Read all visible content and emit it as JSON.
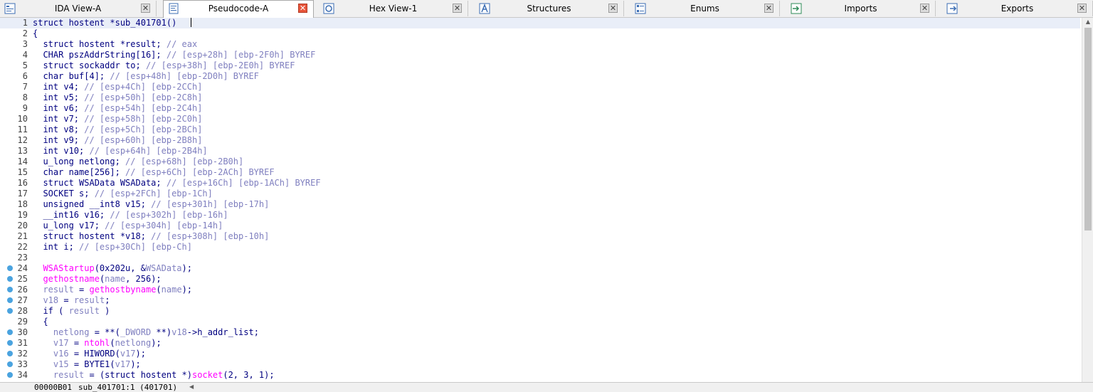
{
  "tabs": [
    {
      "label": "IDA View-A",
      "icon": "ida-view-icon",
      "active": false
    },
    {
      "label": "Pseudocode-A",
      "icon": "pseudocode-icon",
      "active": true
    },
    {
      "label": "Hex View-1",
      "icon": "hex-view-icon",
      "active": false
    },
    {
      "label": "Structures",
      "icon": "structures-icon",
      "active": false
    },
    {
      "label": "Enums",
      "icon": "enums-icon",
      "active": false
    },
    {
      "label": "Imports",
      "icon": "imports-icon",
      "active": false
    },
    {
      "label": "Exports",
      "icon": "exports-icon",
      "active": false
    }
  ],
  "close_glyph": "✕",
  "colors": {
    "keyword": "#000080",
    "comment": "#7f7fbf",
    "function": "#ff00ff",
    "variable": "#8080c0",
    "breakpoint": "#4aa3df",
    "close_active": "#e8553b"
  },
  "code_lines": [
    {
      "n": "1",
      "bp": false,
      "parts": [
        [
          "t",
          "struct hostent *sub_401701()"
        ]
      ]
    },
    {
      "n": "2",
      "bp": false,
      "parts": [
        [
          "t",
          "{"
        ]
      ]
    },
    {
      "n": "3",
      "bp": false,
      "parts": [
        [
          "t",
          "  struct hostent *result; "
        ],
        [
          "c",
          "// eax"
        ]
      ]
    },
    {
      "n": "4",
      "bp": false,
      "parts": [
        [
          "t",
          "  CHAR pszAddrString[16]; "
        ],
        [
          "c",
          "// [esp+28h] [ebp-2F0h] BYREF"
        ]
      ]
    },
    {
      "n": "5",
      "bp": false,
      "parts": [
        [
          "t",
          "  struct sockaddr to; "
        ],
        [
          "c",
          "// [esp+38h] [ebp-2E0h] BYREF"
        ]
      ]
    },
    {
      "n": "6",
      "bp": false,
      "parts": [
        [
          "t",
          "  char buf[4]; "
        ],
        [
          "c",
          "// [esp+48h] [ebp-2D0h] BYREF"
        ]
      ]
    },
    {
      "n": "7",
      "bp": false,
      "parts": [
        [
          "t",
          "  int v4; "
        ],
        [
          "c",
          "// [esp+4Ch] [ebp-2CCh]"
        ]
      ]
    },
    {
      "n": "8",
      "bp": false,
      "parts": [
        [
          "t",
          "  int v5; "
        ],
        [
          "c",
          "// [esp+50h] [ebp-2C8h]"
        ]
      ]
    },
    {
      "n": "9",
      "bp": false,
      "parts": [
        [
          "t",
          "  int v6; "
        ],
        [
          "c",
          "// [esp+54h] [ebp-2C4h]"
        ]
      ]
    },
    {
      "n": "10",
      "bp": false,
      "parts": [
        [
          "t",
          "  int v7; "
        ],
        [
          "c",
          "// [esp+58h] [ebp-2C0h]"
        ]
      ]
    },
    {
      "n": "11",
      "bp": false,
      "parts": [
        [
          "t",
          "  int v8; "
        ],
        [
          "c",
          "// [esp+5Ch] [ebp-2BCh]"
        ]
      ]
    },
    {
      "n": "12",
      "bp": false,
      "parts": [
        [
          "t",
          "  int v9; "
        ],
        [
          "c",
          "// [esp+60h] [ebp-2B8h]"
        ]
      ]
    },
    {
      "n": "13",
      "bp": false,
      "parts": [
        [
          "t",
          "  int v10; "
        ],
        [
          "c",
          "// [esp+64h] [ebp-2B4h]"
        ]
      ]
    },
    {
      "n": "14",
      "bp": false,
      "parts": [
        [
          "t",
          "  u_long netlong; "
        ],
        [
          "c",
          "// [esp+68h] [ebp-2B0h]"
        ]
      ]
    },
    {
      "n": "15",
      "bp": false,
      "parts": [
        [
          "t",
          "  char name[256]; "
        ],
        [
          "c",
          "// [esp+6Ch] [ebp-2ACh] BYREF"
        ]
      ]
    },
    {
      "n": "16",
      "bp": false,
      "parts": [
        [
          "t",
          "  struct WSAData WSAData; "
        ],
        [
          "c",
          "// [esp+16Ch] [ebp-1ACh] BYREF"
        ]
      ]
    },
    {
      "n": "17",
      "bp": false,
      "parts": [
        [
          "t",
          "  SOCKET s; "
        ],
        [
          "c",
          "// [esp+2FCh] [ebp-1Ch]"
        ]
      ]
    },
    {
      "n": "18",
      "bp": false,
      "parts": [
        [
          "t",
          "  unsigned __int8 v15; "
        ],
        [
          "c",
          "// [esp+301h] [ebp-17h]"
        ]
      ]
    },
    {
      "n": "19",
      "bp": false,
      "parts": [
        [
          "t",
          "  __int16 v16; "
        ],
        [
          "c",
          "// [esp+302h] [ebp-16h]"
        ]
      ]
    },
    {
      "n": "20",
      "bp": false,
      "parts": [
        [
          "t",
          "  u_long v17; "
        ],
        [
          "c",
          "// [esp+304h] [ebp-14h]"
        ]
      ]
    },
    {
      "n": "21",
      "bp": false,
      "parts": [
        [
          "t",
          "  struct hostent *v18; "
        ],
        [
          "c",
          "// [esp+308h] [ebp-10h]"
        ]
      ]
    },
    {
      "n": "22",
      "bp": false,
      "parts": [
        [
          "t",
          "  int i; "
        ],
        [
          "c",
          "// [esp+30Ch] [ebp-Ch]"
        ]
      ]
    },
    {
      "n": "23",
      "bp": false,
      "parts": []
    },
    {
      "n": "24",
      "bp": true,
      "parts": [
        [
          "t",
          "  "
        ],
        [
          "f",
          "WSAStartup"
        ],
        [
          "t",
          "(0x202u, &"
        ],
        [
          "v",
          "WSAData"
        ],
        [
          "t",
          ");"
        ]
      ]
    },
    {
      "n": "25",
      "bp": true,
      "parts": [
        [
          "t",
          "  "
        ],
        [
          "f",
          "gethostname"
        ],
        [
          "t",
          "("
        ],
        [
          "v",
          "name"
        ],
        [
          "t",
          ", 256);"
        ]
      ]
    },
    {
      "n": "26",
      "bp": true,
      "parts": [
        [
          "t",
          "  "
        ],
        [
          "v",
          "result"
        ],
        [
          "t",
          " = "
        ],
        [
          "f",
          "gethostbyname"
        ],
        [
          "t",
          "("
        ],
        [
          "v",
          "name"
        ],
        [
          "t",
          ");"
        ]
      ]
    },
    {
      "n": "27",
      "bp": true,
      "parts": [
        [
          "t",
          "  "
        ],
        [
          "v",
          "v18"
        ],
        [
          "t",
          " = "
        ],
        [
          "v",
          "result"
        ],
        [
          "t",
          ";"
        ]
      ]
    },
    {
      "n": "28",
      "bp": true,
      "parts": [
        [
          "t",
          "  if ( "
        ],
        [
          "v",
          "result"
        ],
        [
          "t",
          " )"
        ]
      ]
    },
    {
      "n": "29",
      "bp": false,
      "parts": [
        [
          "t",
          "  {"
        ]
      ]
    },
    {
      "n": "30",
      "bp": true,
      "parts": [
        [
          "t",
          "    "
        ],
        [
          "v",
          "netlong"
        ],
        [
          "t",
          " = **("
        ],
        [
          "v",
          "_DWORD"
        ],
        [
          "t",
          " **)"
        ],
        [
          "v",
          "v18"
        ],
        [
          "t",
          "->h_addr_list;"
        ]
      ]
    },
    {
      "n": "31",
      "bp": true,
      "parts": [
        [
          "t",
          "    "
        ],
        [
          "v",
          "v17"
        ],
        [
          "t",
          " = "
        ],
        [
          "f",
          "ntohl"
        ],
        [
          "t",
          "("
        ],
        [
          "v",
          "netlong"
        ],
        [
          "t",
          ");"
        ]
      ]
    },
    {
      "n": "32",
      "bp": true,
      "parts": [
        [
          "t",
          "    "
        ],
        [
          "v",
          "v16"
        ],
        [
          "t",
          " = HIWORD("
        ],
        [
          "v",
          "v17"
        ],
        [
          "t",
          ");"
        ]
      ]
    },
    {
      "n": "33",
      "bp": true,
      "parts": [
        [
          "t",
          "    "
        ],
        [
          "v",
          "v15"
        ],
        [
          "t",
          " = BYTE1("
        ],
        [
          "v",
          "v17"
        ],
        [
          "t",
          ");"
        ]
      ]
    },
    {
      "n": "34",
      "bp": true,
      "parts": [
        [
          "t",
          "    "
        ],
        [
          "v",
          "result"
        ],
        [
          "t",
          " = (struct hostent *)"
        ],
        [
          "f",
          "socket"
        ],
        [
          "t",
          "(2, 3, 1);"
        ]
      ]
    }
  ],
  "status": {
    "address": "00000B01",
    "location": "sub_401701:1 (401701)"
  },
  "scroll": {
    "up_glyph": "▲",
    "left_glyph": "◀"
  }
}
